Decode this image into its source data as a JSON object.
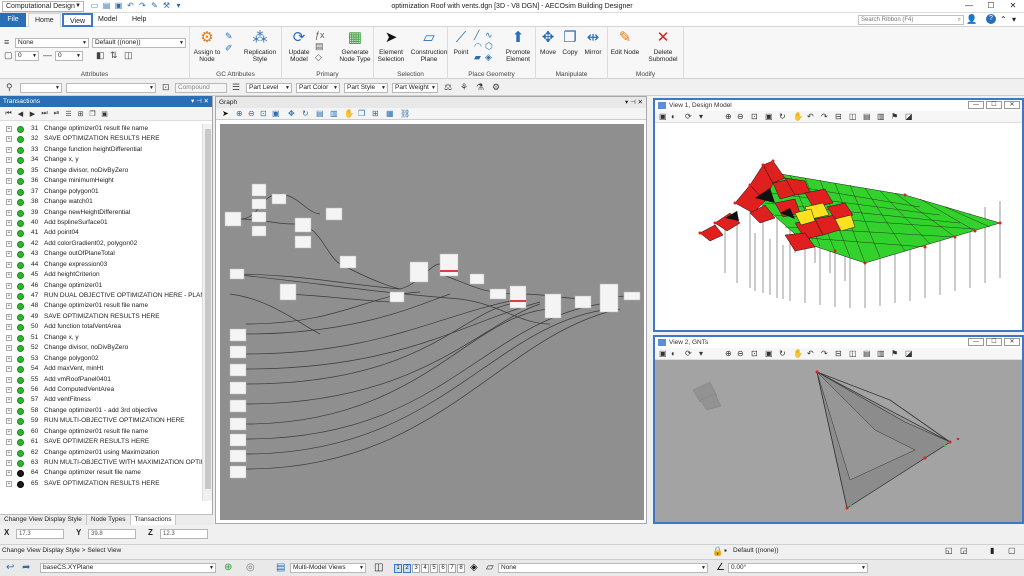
{
  "titlebar": {
    "workspace": "Computational Design",
    "title": "optimization Roof with vents.dgn [3D - V8 DGN] - AECOsim Building Designer",
    "minimize": "—",
    "maximize": "☐",
    "close": "✕"
  },
  "tabs": {
    "file": "File",
    "home": "Home",
    "view": "View",
    "model": "Model",
    "help": "Help"
  },
  "search": {
    "placeholder": "Search Ribbon (F4)"
  },
  "ribbon": {
    "attributes": {
      "level": "None",
      "style": "Default ((none))",
      "color_value": "0",
      "weight_value": "0",
      "label": "Attributes"
    },
    "gc_attributes": {
      "assign": "Assign to Node",
      "replication": "Replication Style",
      "label": "GC Attributes"
    },
    "primary": {
      "update": "Update Model",
      "generate": "Generate Node Type",
      "label": "Primary"
    },
    "selection": {
      "element": "Element Selection",
      "construction": "Construction Plane",
      "label": "Selection"
    },
    "place_geometry": {
      "point": "Point",
      "promote": "Promote Element",
      "label": "Place Geometry"
    },
    "manipulate": {
      "move": "Move",
      "copy": "Copy",
      "mirror": "Mirror",
      "label": "Manipulate"
    },
    "modify": {
      "edit": "Edit Node",
      "delete": "Delete Submodel",
      "label": "Modify"
    }
  },
  "attrbar": {
    "compound": "Compound",
    "part_level": "Part Level",
    "part_color": "Part Color",
    "part_style": "Part Style",
    "part_weight": "Part Weight"
  },
  "transactions": {
    "title": "Transactions",
    "items": [
      {
        "n": "31",
        "text": "Change optimizer01 result file name",
        "state": "done"
      },
      {
        "n": "32",
        "text": "SAVE OPTIMIZATION RESULTS HERE",
        "state": "done"
      },
      {
        "n": "33",
        "text": "Change function heightDifferential",
        "state": "done"
      },
      {
        "n": "34",
        "text": "Change x, y",
        "state": "done"
      },
      {
        "n": "35",
        "text": "Change divisor, noDivByZero",
        "state": "done"
      },
      {
        "n": "36",
        "text": "Change minimumHeight",
        "state": "done"
      },
      {
        "n": "37",
        "text": "Change polygon01",
        "state": "done"
      },
      {
        "n": "38",
        "text": "Change watch01",
        "state": "done"
      },
      {
        "n": "39",
        "text": "Change newHeightDifferential",
        "state": "done"
      },
      {
        "n": "40",
        "text": "Add bsplineSurface01",
        "state": "done"
      },
      {
        "n": "41",
        "text": "Add point04",
        "state": "done"
      },
      {
        "n": "42",
        "text": "Add colorGradient02, polygon02",
        "state": "done"
      },
      {
        "n": "43",
        "text": "Change outOfPlaneTotal",
        "state": "done"
      },
      {
        "n": "44",
        "text": "Change expression03",
        "state": "done"
      },
      {
        "n": "45",
        "text": "Add heightCriterion",
        "state": "done"
      },
      {
        "n": "46",
        "text": "Change optimizer01",
        "state": "done"
      },
      {
        "n": "47",
        "text": "RUN DUAL OBJECTIVE OPTIMIZATION HERE - PLANAR R",
        "state": "done"
      },
      {
        "n": "48",
        "text": "Change optimizer01 result file name",
        "state": "done"
      },
      {
        "n": "49",
        "text": "SAVE OPTIMIZATION RESULTS HERE",
        "state": "done"
      },
      {
        "n": "50",
        "text": "Add function totalVentArea",
        "state": "done"
      },
      {
        "n": "51",
        "text": "Change x, y",
        "state": "done"
      },
      {
        "n": "52",
        "text": "Change divisor, noDivByZero",
        "state": "done"
      },
      {
        "n": "53",
        "text": "Change polygon02",
        "state": "done"
      },
      {
        "n": "54",
        "text": "Add maxVent, minHt",
        "state": "done"
      },
      {
        "n": "55",
        "text": "Add vmRoofPanel0401",
        "state": "done"
      },
      {
        "n": "56",
        "text": "Add ComputedVentArea",
        "state": "done"
      },
      {
        "n": "57",
        "text": "Add ventFitness",
        "state": "done"
      },
      {
        "n": "58",
        "text": "Change optimizer01 - add 3rd objective",
        "state": "done"
      },
      {
        "n": "59",
        "text": "RUN MULTI-OBJECTIVE OPTIMIZATION HERE",
        "state": "done"
      },
      {
        "n": "60",
        "text": "Change optimizer01 result file name",
        "state": "done"
      },
      {
        "n": "61",
        "text": "SAVE OPTIMIZER RESULTS HERE",
        "state": "done"
      },
      {
        "n": "62",
        "text": "Change optimizer01 using Maximization",
        "state": "done"
      },
      {
        "n": "63",
        "text": "RUN MULTI-OBJECTIVE WITH MAXIMIZATION OPTIMIZA",
        "state": "done"
      },
      {
        "n": "64",
        "text": "Change optimizer result file name",
        "state": "pending"
      },
      {
        "n": "65",
        "text": "SAVE OPTIMIZATION RESULTS HERE",
        "state": "pending"
      }
    ],
    "bottom_tabs": [
      "Change View Display Style",
      "Node Types",
      "Transactions"
    ]
  },
  "graph": {
    "title": "Graph"
  },
  "views": {
    "view1": {
      "title": "View 1, Design Model"
    },
    "view2": {
      "title": "View 2, GNTs"
    }
  },
  "coords": {
    "x_label": "X",
    "x": "17.3",
    "y_label": "Y",
    "y": "39.8",
    "z_label": "Z",
    "z": "12.3"
  },
  "status": {
    "prompt": "Change View Display Style > Select View",
    "active": "Default ((none))"
  },
  "footer": {
    "acs": "baseCS.XYPlane",
    "views": "Multi-Model Views",
    "view_numbers": [
      "1",
      "2",
      "3",
      "4",
      "5",
      "6",
      "7",
      "8"
    ],
    "level": "None",
    "angle": "0.00°"
  }
}
